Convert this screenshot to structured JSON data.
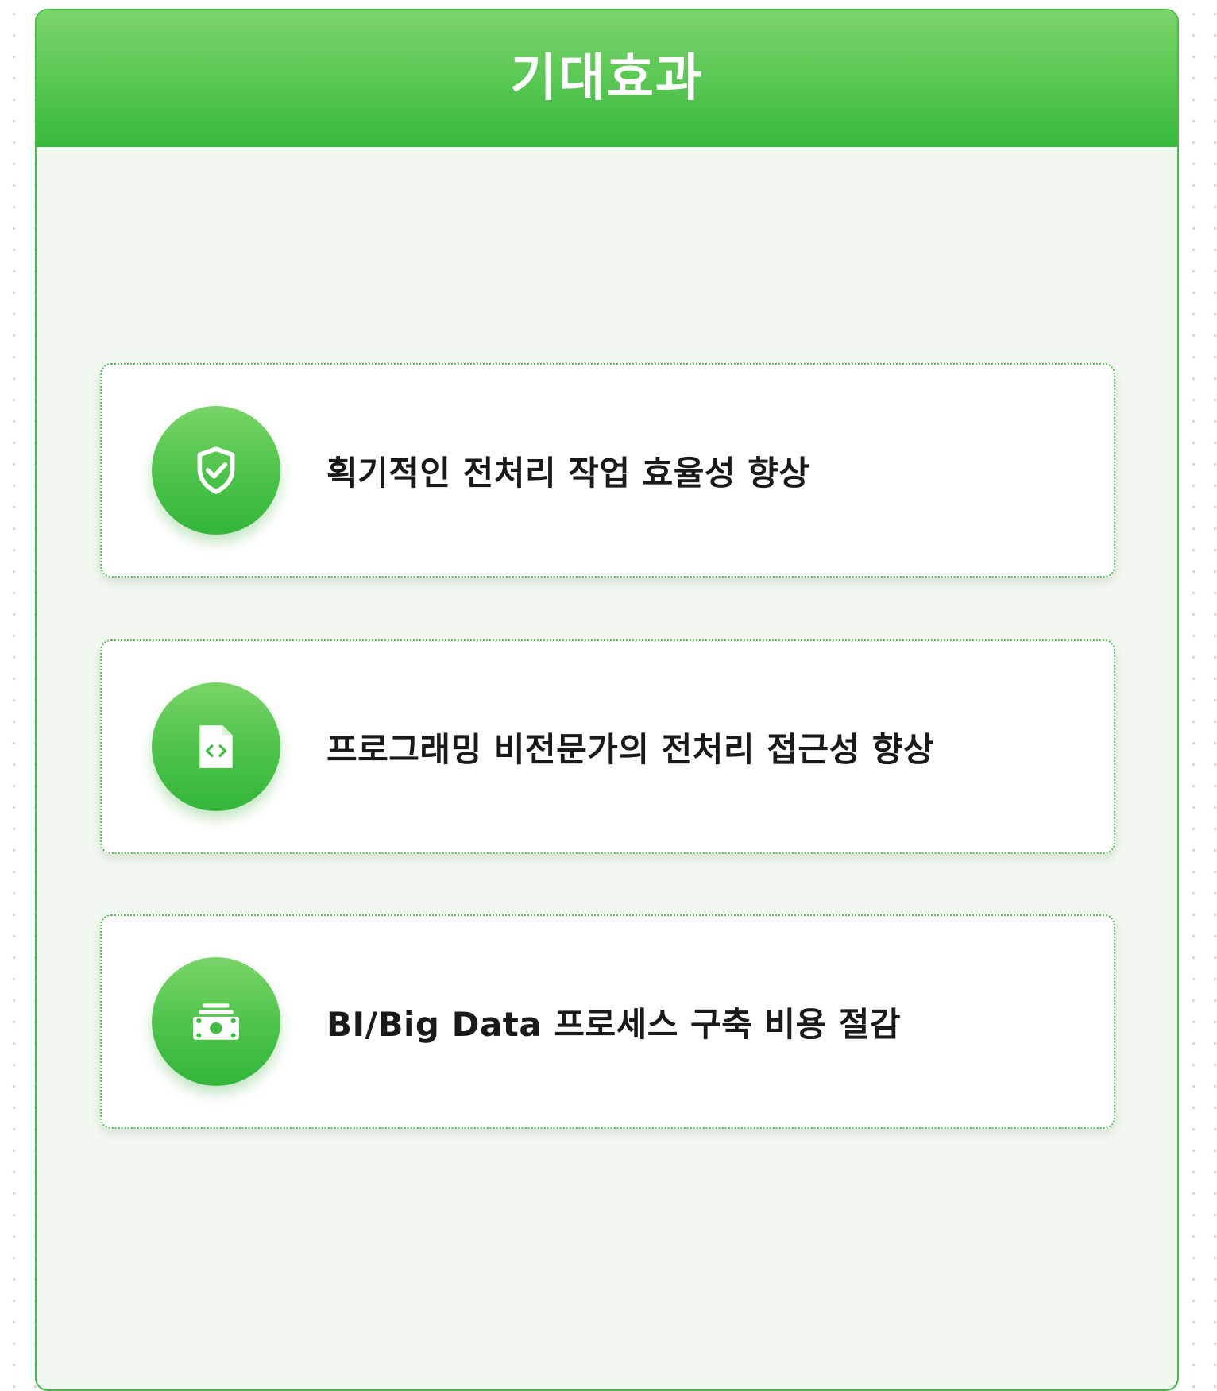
{
  "header": {
    "title": "기대효과"
  },
  "cards": [
    {
      "icon": "shield-check-icon",
      "text": "획기적인 전처리 작업 효율성 향상"
    },
    {
      "icon": "code-file-icon",
      "text": "프로그래밍 비전문가의 전처리 접근성 향상"
    },
    {
      "icon": "money-stack-icon",
      "text": "BI/Big Data 프로세스 구축 비용 절감"
    }
  ],
  "colors": {
    "accent": "#3cba3c",
    "header_top": "#7bd46b",
    "header_bottom": "#36b83c",
    "panel_background": "#f1f8ef",
    "card_border": "#57c257",
    "text": "#1a1a1a"
  }
}
